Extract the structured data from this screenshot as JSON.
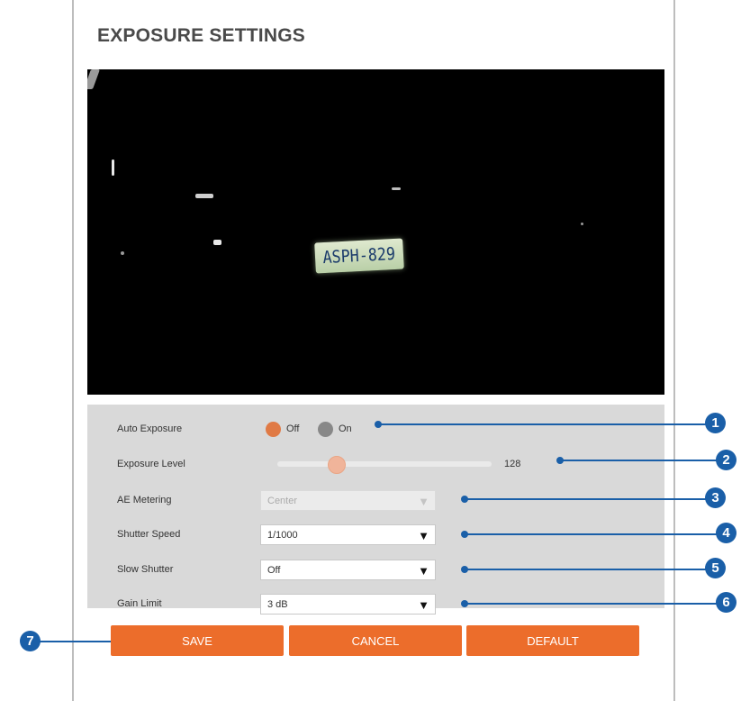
{
  "page": {
    "title": "EXPOSURE SETTINGS"
  },
  "preview": {
    "plate_text": "ASPH-829"
  },
  "settings": {
    "auto_exposure": {
      "label": "Auto Exposure",
      "options": [
        "Off",
        "On"
      ],
      "selected": "Off"
    },
    "exposure_level": {
      "label": "Exposure Level",
      "value": "128"
    },
    "ae_metering": {
      "label": "AE Metering",
      "value": "Center",
      "disabled": true
    },
    "shutter_speed": {
      "label": "Shutter Speed",
      "value": "1/1000"
    },
    "slow_shutter": {
      "label": "Slow Shutter",
      "value": "Off"
    },
    "gain_limit": {
      "label": "Gain Limit",
      "value": "3 dB"
    }
  },
  "buttons": {
    "save": "SAVE",
    "cancel": "CANCEL",
    "default": "DEFAULT"
  },
  "callouts": [
    "1",
    "2",
    "3",
    "4",
    "5",
    "6",
    "7"
  ],
  "colors": {
    "accent": "#ec6d2b",
    "callout": "#1a5fa8",
    "settings_bg": "#d9d9d9",
    "radio_selected": "#e07a45",
    "radio_unselected": "#888888"
  },
  "icons": {
    "dropdown": "triangle-down-icon"
  }
}
